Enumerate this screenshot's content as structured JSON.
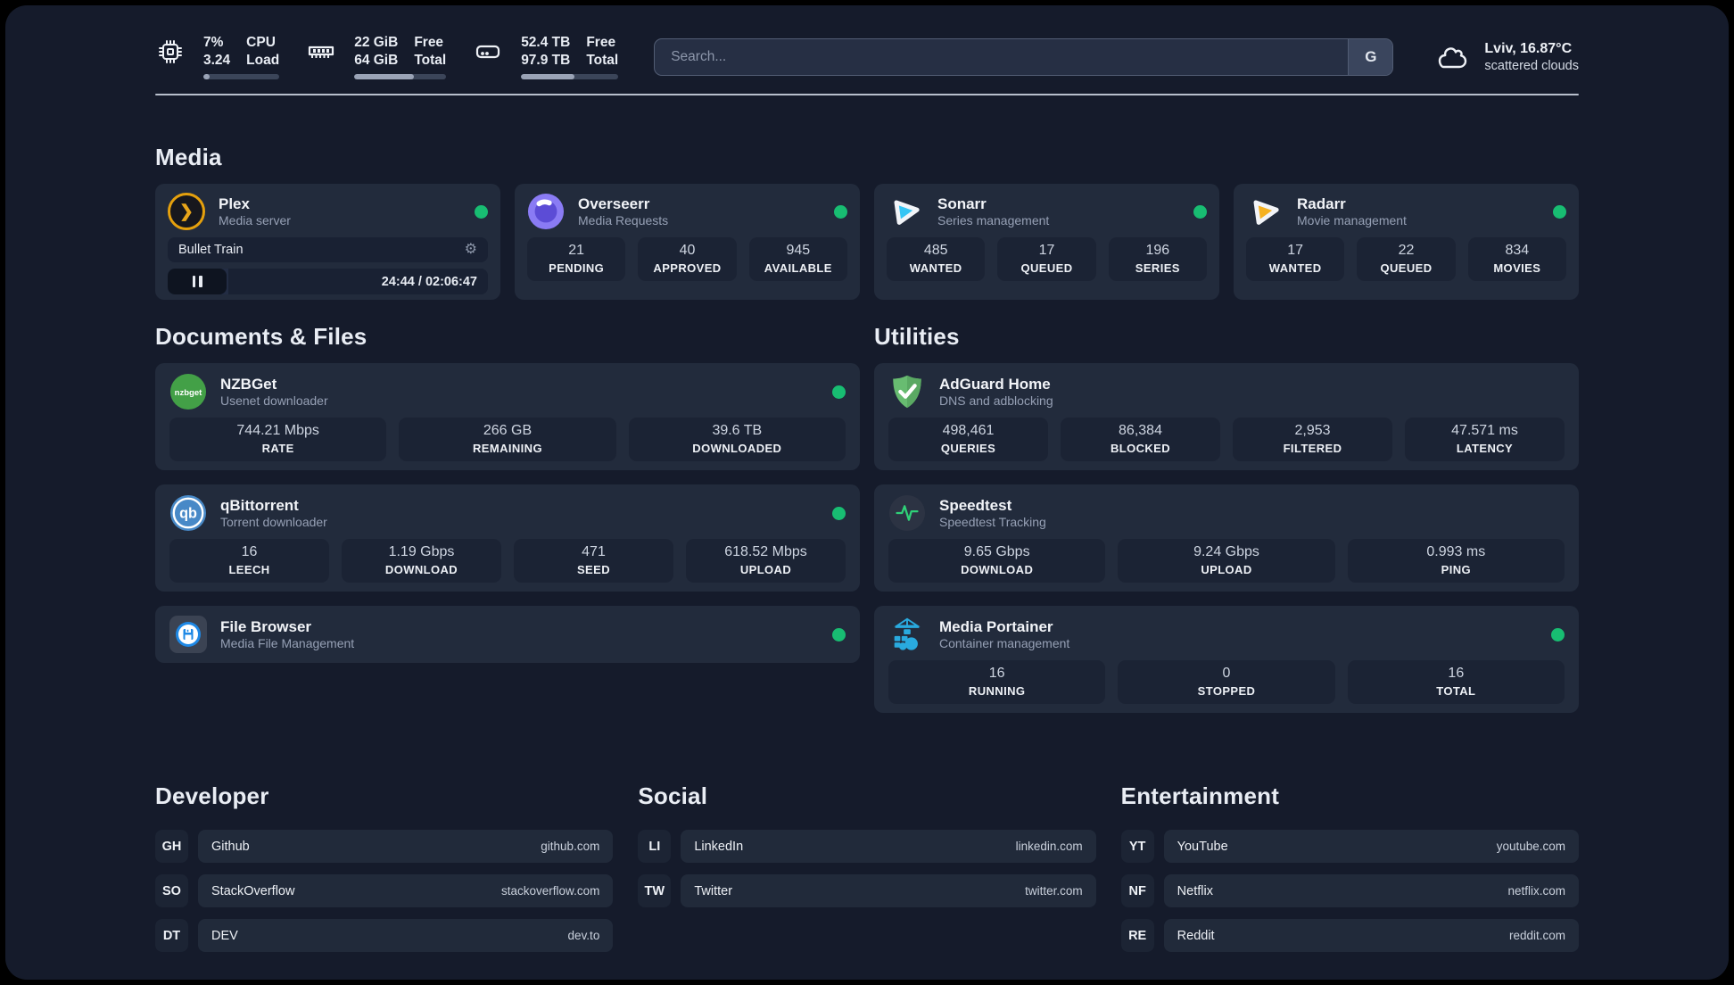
{
  "top_bar": {
    "stats": [
      {
        "icon": "cpu-chip-icon",
        "value_top": "7%",
        "value_bottom": "3.24",
        "label_top": "CPU",
        "label_bottom": "Load",
        "progress_percent": 8
      },
      {
        "icon": "memory-icon",
        "value_top": "22 GiB",
        "value_bottom": "64 GiB",
        "label_top": "Free",
        "label_bottom": "Total",
        "progress_percent": 65
      },
      {
        "icon": "disk-icon",
        "value_top": "52.4 TB",
        "value_bottom": "97.9 TB",
        "label_top": "Free",
        "label_bottom": "Total",
        "progress_percent": 55
      }
    ],
    "search": {
      "placeholder": "Search...",
      "engine_label": "G"
    },
    "weather": {
      "location": "Lviv, 16.87°C",
      "condition": "scattered clouds"
    }
  },
  "sections": {
    "media": {
      "title": "Media"
    },
    "documents": {
      "title": "Documents & Files"
    },
    "utilities": {
      "title": "Utilities"
    }
  },
  "apps": {
    "plex": {
      "name": "Plex",
      "subtitle": "Media server",
      "now_playing": "Bullet Train",
      "time": "24:44 / 02:06:47",
      "progress_percent": 19
    },
    "overseerr": {
      "name": "Overseerr",
      "subtitle": "Media Requests",
      "stats": [
        {
          "value": "21",
          "label": "PENDING"
        },
        {
          "value": "40",
          "label": "APPROVED"
        },
        {
          "value": "945",
          "label": "AVAILABLE"
        }
      ]
    },
    "sonarr": {
      "name": "Sonarr",
      "subtitle": "Series management",
      "stats": [
        {
          "value": "485",
          "label": "WANTED"
        },
        {
          "value": "17",
          "label": "QUEUED"
        },
        {
          "value": "196",
          "label": "SERIES"
        }
      ]
    },
    "radarr": {
      "name": "Radarr",
      "subtitle": "Movie management",
      "stats": [
        {
          "value": "17",
          "label": "WANTED"
        },
        {
          "value": "22",
          "label": "QUEUED"
        },
        {
          "value": "834",
          "label": "MOVIES"
        }
      ]
    },
    "nzbget": {
      "name": "NZBGet",
      "subtitle": "Usenet downloader",
      "stats": [
        {
          "value": "744.21 Mbps",
          "label": "RATE"
        },
        {
          "value": "266 GB",
          "label": "REMAINING"
        },
        {
          "value": "39.6 TB",
          "label": "DOWNLOADED"
        }
      ]
    },
    "qbittorrent": {
      "name": "qBittorrent",
      "subtitle": "Torrent downloader",
      "stats": [
        {
          "value": "16",
          "label": "LEECH"
        },
        {
          "value": "1.19 Gbps",
          "label": "DOWNLOAD"
        },
        {
          "value": "471",
          "label": "SEED"
        },
        {
          "value": "618.52 Mbps",
          "label": "UPLOAD"
        }
      ]
    },
    "filebrowser": {
      "name": "File Browser",
      "subtitle": "Media File Management"
    },
    "adguard": {
      "name": "AdGuard Home",
      "subtitle": "DNS and adblocking",
      "stats": [
        {
          "value": "498,461",
          "label": "QUERIES"
        },
        {
          "value": "86,384",
          "label": "BLOCKED"
        },
        {
          "value": "2,953",
          "label": "FILTERED"
        },
        {
          "value": "47.571 ms",
          "label": "LATENCY"
        }
      ]
    },
    "speedtest": {
      "name": "Speedtest",
      "subtitle": "Speedtest Tracking",
      "stats": [
        {
          "value": "9.65 Gbps",
          "label": "DOWNLOAD"
        },
        {
          "value": "9.24 Gbps",
          "label": "UPLOAD"
        },
        {
          "value": "0.993 ms",
          "label": "PING"
        }
      ]
    },
    "portainer": {
      "name": "Media Portainer",
      "subtitle": "Container management",
      "stats": [
        {
          "value": "16",
          "label": "RUNNING"
        },
        {
          "value": "0",
          "label": "STOPPED"
        },
        {
          "value": "16",
          "label": "TOTAL"
        }
      ]
    }
  },
  "link_groups": [
    {
      "title": "Developer",
      "links": [
        {
          "abbr": "GH",
          "name": "Github",
          "url": "github.com"
        },
        {
          "abbr": "SO",
          "name": "StackOverflow",
          "url": "stackoverflow.com"
        },
        {
          "abbr": "DT",
          "name": "DEV",
          "url": "dev.to"
        }
      ]
    },
    {
      "title": "Social",
      "links": [
        {
          "abbr": "LI",
          "name": "LinkedIn",
          "url": "linkedin.com"
        },
        {
          "abbr": "TW",
          "name": "Twitter",
          "url": "twitter.com"
        }
      ]
    },
    {
      "title": "Entertainment",
      "links": [
        {
          "abbr": "YT",
          "name": "YouTube",
          "url": "youtube.com"
        },
        {
          "abbr": "NF",
          "name": "Netflix",
          "url": "netflix.com"
        },
        {
          "abbr": "RE",
          "name": "Reddit",
          "url": "reddit.com"
        }
      ]
    }
  ],
  "icons": {
    "pause": "pause-icon",
    "settings": "settings-icon",
    "cloud": "cloud-icon"
  },
  "colors": {
    "status_online": "#18bd72",
    "plex_accent": "#e5a00d",
    "page_bg": "#151b2b",
    "card_bg": "#222b3c"
  }
}
